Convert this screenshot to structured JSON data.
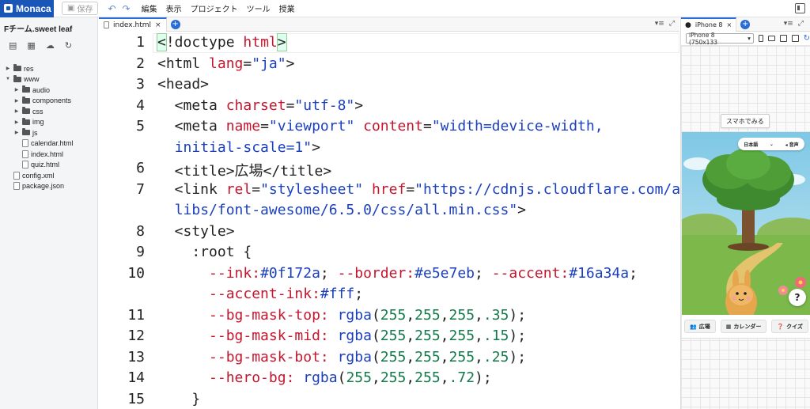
{
  "app": {
    "logo": "Monaca",
    "save_label": "保存"
  },
  "menu": [
    "編集",
    "表示",
    "プロジェクト",
    "ツール",
    "授業"
  ],
  "sidebar": {
    "project_title": "Fチーム.sweet leaf",
    "tree": [
      {
        "label": "res",
        "type": "folder",
        "depth": 0,
        "arrow": "▶"
      },
      {
        "label": "www",
        "type": "folder",
        "depth": 0,
        "arrow": "▼"
      },
      {
        "label": "audio",
        "type": "folder",
        "depth": 1,
        "arrow": "▶"
      },
      {
        "label": "components",
        "type": "folder",
        "depth": 1,
        "arrow": "▶"
      },
      {
        "label": "css",
        "type": "folder",
        "depth": 1,
        "arrow": "▶"
      },
      {
        "label": "img",
        "type": "folder",
        "depth": 1,
        "arrow": "▶"
      },
      {
        "label": "js",
        "type": "folder",
        "depth": 1,
        "arrow": "▶"
      },
      {
        "label": "calendar.html",
        "type": "file",
        "depth": 1,
        "arrow": ""
      },
      {
        "label": "index.html",
        "type": "file",
        "depth": 1,
        "arrow": ""
      },
      {
        "label": "quiz.html",
        "type": "file",
        "depth": 1,
        "arrow": ""
      },
      {
        "label": "config.xml",
        "type": "file",
        "depth": 0,
        "arrow": ""
      },
      {
        "label": "package.json",
        "type": "file",
        "depth": 0,
        "arrow": ""
      }
    ]
  },
  "editor": {
    "tab_label": "index.html",
    "close_glyph": "×",
    "add_glyph": "+",
    "lines": [
      {
        "n": "1",
        "html": "<span class=\"t-hl\">&lt;</span>!doctype <span class=\"t-kw\">html</span><span class=\"t-hl\">&gt;</span>"
      },
      {
        "n": "2",
        "html": "&lt;html <span class=\"t-attr\">lang</span>=<span class=\"t-str\">\"ja\"</span>&gt;"
      },
      {
        "n": "3",
        "html": "&lt;head&gt;"
      },
      {
        "n": "4",
        "html": "  &lt;meta <span class=\"t-attr\">charset</span>=<span class=\"t-str\">\"utf-8\"</span>&gt;"
      },
      {
        "n": "5",
        "html": "  &lt;meta <span class=\"t-attr\">name</span>=<span class=\"t-str\">\"viewport\"</span> <span class=\"t-attr\">content</span>=<span class=\"t-str\">\"width=device-width,</span>"
      },
      {
        "n": "",
        "html": "  <span class=\"t-str\">initial-scale=1\"</span>&gt;"
      },
      {
        "n": "6",
        "html": "  &lt;title&gt;広場&lt;/title&gt;"
      },
      {
        "n": "7",
        "html": "  &lt;link <span class=\"t-attr\">rel</span>=<span class=\"t-str\">\"stylesheet\"</span> <span class=\"t-attr\">href</span>=<span class=\"t-str\">\"https://cdnjs.cloudflare.com/ajax/</span>"
      },
      {
        "n": "",
        "html": "  <span class=\"t-str\">libs/font-awesome/6.5.0/css/all.min.css\"</span>&gt;"
      },
      {
        "n": "8",
        "html": "  &lt;style&gt;"
      },
      {
        "n": "9",
        "html": "    :root {"
      },
      {
        "n": "10",
        "html": "      <span class=\"t-var\">--ink:</span><span class=\"t-str\">#0f172a</span>; <span class=\"t-var\">--border:</span><span class=\"t-str\">#e5e7eb</span>; <span class=\"t-var\">--accent:</span><span class=\"t-str\">#16a34a</span>;"
      },
      {
        "n": "",
        "html": "      <span class=\"t-var\">--accent-ink:</span><span class=\"t-str\">#fff</span>;"
      },
      {
        "n": "11",
        "html": "      <span class=\"t-var\">--bg-mask-top:</span> <span class=\"t-str\">rgba</span>(<span class=\"t-num\">255</span>,<span class=\"t-num\">255</span>,<span class=\"t-num\">255</span>,<span class=\"t-num\">.35</span>);"
      },
      {
        "n": "12",
        "html": "      <span class=\"t-var\">--bg-mask-mid:</span> <span class=\"t-str\">rgba</span>(<span class=\"t-num\">255</span>,<span class=\"t-num\">255</span>,<span class=\"t-num\">255</span>,<span class=\"t-num\">.15</span>);"
      },
      {
        "n": "13",
        "html": "      <span class=\"t-var\">--bg-mask-bot:</span> <span class=\"t-str\">rgba</span>(<span class=\"t-num\">255</span>,<span class=\"t-num\">255</span>,<span class=\"t-num\">255</span>,<span class=\"t-num\">.25</span>);"
      },
      {
        "n": "14",
        "html": "      <span class=\"t-var\">--hero-bg:</span> <span class=\"t-str\">rgba</span>(<span class=\"t-num\">255</span>,<span class=\"t-num\">255</span>,<span class=\"t-num\">255</span>,<span class=\"t-num\">.72</span>);"
      },
      {
        "n": "15",
        "html": "    }"
      }
    ]
  },
  "preview": {
    "tab_label": "iPhone 8",
    "device_select": "iPhone 8 (750x133",
    "sumaho_label": "スマホでみる",
    "lang_select": "日本語",
    "sound_label": "音声",
    "help_glyph": "?",
    "nav": [
      {
        "label": "広場",
        "icon": "users-icon"
      },
      {
        "label": "カレンダー",
        "icon": "calendar-icon"
      },
      {
        "label": "クイズ",
        "icon": "question-circle-icon"
      }
    ]
  },
  "colors": {
    "brand": "#1a56b8",
    "accent_tab": "#2a6cd6",
    "code_keyword": "#c5162e",
    "code_string": "#1a3fbf",
    "code_number": "#127a4a"
  }
}
